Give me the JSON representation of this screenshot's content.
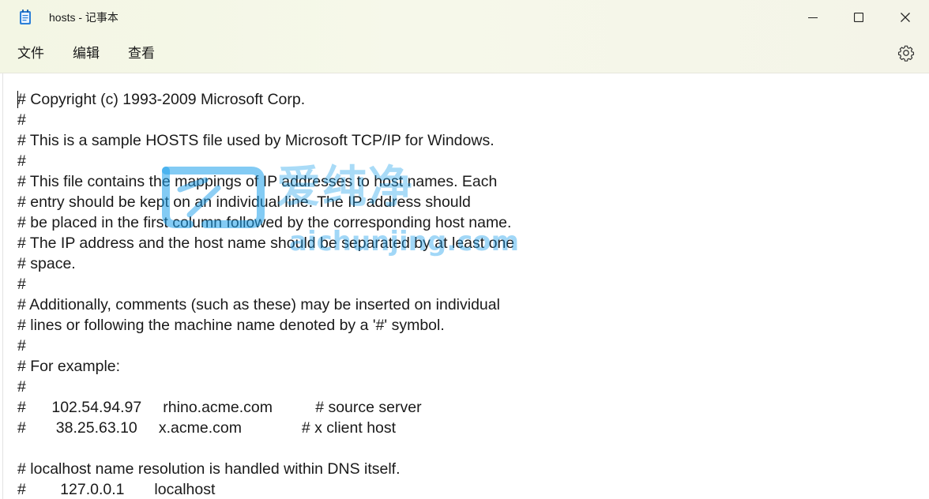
{
  "window": {
    "title": "hosts - 记事本",
    "icons": {
      "app": "notepad-icon",
      "minimize": "minimize-icon",
      "maximize": "maximize-icon",
      "close": "close-icon"
    }
  },
  "menu": {
    "file": "文件",
    "edit": "编辑",
    "view": "查看",
    "settings_icon": "gear-icon"
  },
  "document": {
    "content": "# Copyright (c) 1993-2009 Microsoft Corp.\n#\n# This is a sample HOSTS file used by Microsoft TCP/IP for Windows.\n#\n# This file contains the mappings of IP addresses to host names. Each\n# entry should be kept on an individual line. The IP address should\n# be placed in the first column followed by the corresponding host name.\n# The IP address and the host name should be separated by at least one\n# space.\n#\n# Additionally, comments (such as these) may be inserted on individual\n# lines or following the machine name denoted by a '#' symbol.\n#\n# For example:\n#\n#      102.54.94.97     rhino.acme.com          # source server\n#       38.25.63.10     x.acme.com              # x client host\n\n# localhost name resolution is handled within DNS itself.\n#        127.0.0.1       localhost"
  },
  "watermark": {
    "chars": "爱纯净",
    "url": "aichunjing.com",
    "color": "#1ea0eb"
  }
}
